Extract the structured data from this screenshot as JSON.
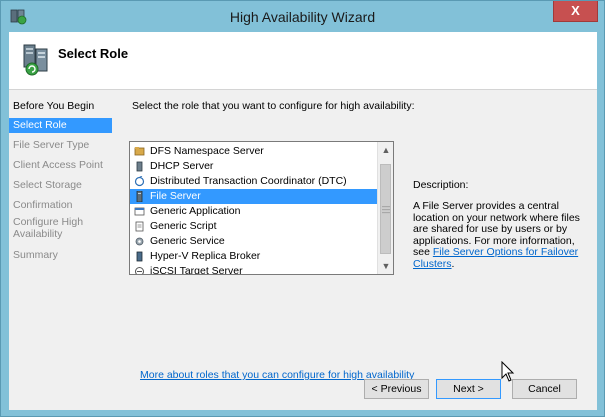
{
  "window": {
    "title": "High Availability Wizard",
    "close_label": "X"
  },
  "header": {
    "title": "Select Role"
  },
  "nav": {
    "items": [
      {
        "label": "Before You Begin",
        "state": "done"
      },
      {
        "label": "Select Role",
        "state": "active"
      },
      {
        "label": "File Server Type",
        "state": "pending"
      },
      {
        "label": "Client Access Point",
        "state": "pending"
      },
      {
        "label": "Select Storage",
        "state": "pending"
      },
      {
        "label": "Confirmation",
        "state": "pending"
      },
      {
        "label": "Configure High Availability",
        "state": "pending"
      },
      {
        "label": "Summary",
        "state": "pending"
      }
    ]
  },
  "main": {
    "prompt": "Select the role that you want to configure for high availability:",
    "roles": [
      {
        "label": "DFS Namespace Server",
        "icon": "dfs-icon"
      },
      {
        "label": "DHCP Server",
        "icon": "dhcp-icon"
      },
      {
        "label": "Distributed Transaction Coordinator (DTC)",
        "icon": "dtc-icon"
      },
      {
        "label": "File Server",
        "icon": "file-server-icon",
        "selected": true
      },
      {
        "label": "Generic Application",
        "icon": "generic-application-icon"
      },
      {
        "label": "Generic Script",
        "icon": "generic-script-icon"
      },
      {
        "label": "Generic Service",
        "icon": "generic-service-icon"
      },
      {
        "label": "Hyper-V Replica Broker",
        "icon": "hyperv-icon"
      },
      {
        "label": "iSCSI Target Server",
        "icon": "iscsi-icon"
      }
    ],
    "description_label": "Description:",
    "description_text": "A File Server provides a central location on your network where files are shared for use by users or by applications. For more information, see ",
    "description_link": "File Server Options for Failover Clusters",
    "description_end": ".",
    "more_link": "More about roles that you can configure for high availability"
  },
  "buttons": {
    "previous": "< Previous",
    "next": "Next >",
    "cancel": "Cancel"
  },
  "colors": {
    "titlebar": "#82c1d8",
    "selection": "#3399ff",
    "close": "#c75050",
    "link": "#0066cc"
  }
}
